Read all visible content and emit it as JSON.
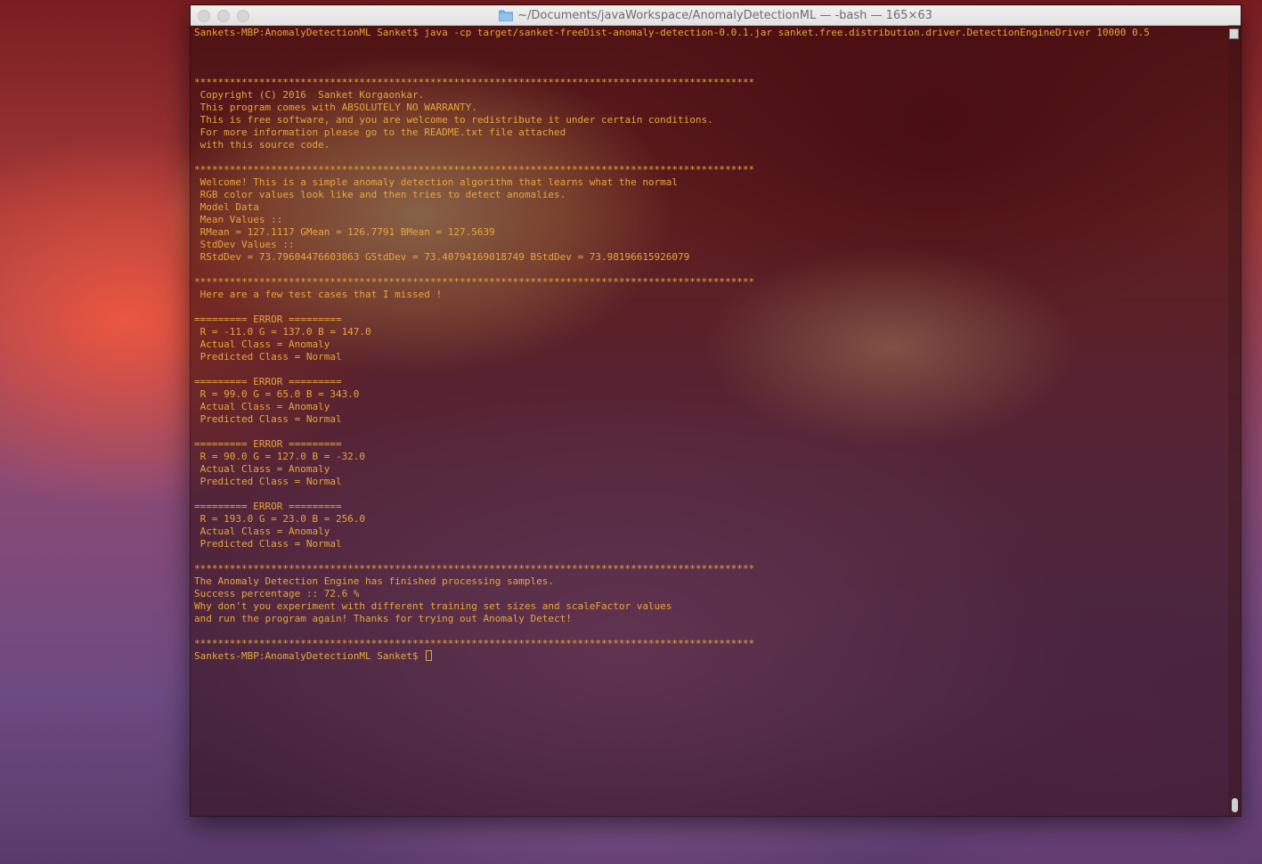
{
  "window": {
    "title": "~/Documents/javaWorkspace/AnomalyDetectionML — -bash — 165×63"
  },
  "terminal": {
    "prompt": "Sankets-MBP:AnomalyDetectionML Sanket$ ",
    "lines": [
      "Sankets-MBP:AnomalyDetectionML Sanket$ java -cp target/sanket-freeDist-anomaly-detection-0.0.1.jar sanket.free.distribution.driver.DetectionEngineDriver 10000 0.5",
      "",
      "",
      "",
      "***********************************************************************************************",
      " Copyright (C) 2016  Sanket Korgaonkar.",
      " This program comes with ABSOLUTELY NO WARRANTY.",
      " This is free software, and you are welcome to redistribute it under certain conditions.",
      " For more information please go to the README.txt file attached",
      " with this source code.",
      "",
      "***********************************************************************************************",
      " Welcome! This is a simple anomaly detection algorithm that learns what the normal",
      " RGB color values look like and then tries to detect anomalies.",
      " Model Data",
      " Mean Values ::",
      " RMean = 127.1117 GMean = 126.7791 BMean = 127.5639",
      " StdDev Values ::",
      " RStdDev = 73.79604476603063 GStdDev = 73.40794169018749 BStdDev = 73.98196615926079",
      "",
      "***********************************************************************************************",
      " Here are a few test cases that I missed !",
      "",
      "========= ERROR =========",
      " R = -11.0 G = 137.0 B = 147.0",
      " Actual Class = Anomaly",
      " Predicted Class = Normal",
      "",
      "========= ERROR =========",
      " R = 99.0 G = 65.0 B = 343.0",
      " Actual Class = Anomaly",
      " Predicted Class = Normal",
      "",
      "========= ERROR =========",
      " R = 90.0 G = 127.0 B = -32.0",
      " Actual Class = Anomaly",
      " Predicted Class = Normal",
      "",
      "========= ERROR =========",
      " R = 193.0 G = 23.0 B = 256.0",
      " Actual Class = Anomaly",
      " Predicted Class = Normal",
      "",
      "***********************************************************************************************",
      "The Anomaly Detection Engine has finished processing samples.",
      "Success percentage :: 72.6 %",
      "Why don't you experiment with different training set sizes and scaleFactor values",
      "and run the program again! Thanks for trying out Anomaly Detect!",
      "",
      "***********************************************************************************************"
    ]
  },
  "colors": {
    "terminal_text": "#e9a53a"
  },
  "icons": {
    "title_folder": "folder-icon"
  }
}
